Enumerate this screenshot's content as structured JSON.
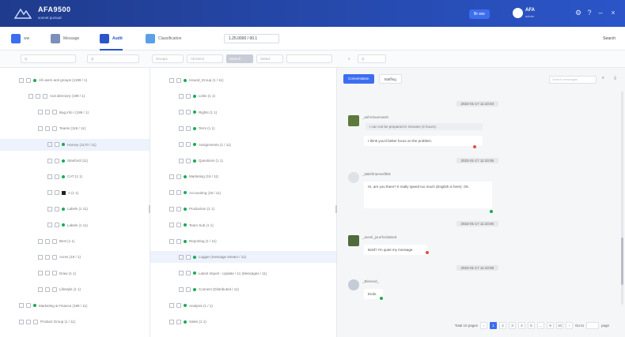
{
  "app": {
    "name": "AFA9500",
    "subtitle": "sonnet pursual"
  },
  "titlebar": {
    "button": "Br ww",
    "user_name": "AFA",
    "user_sub": "admin"
  },
  "colors": {
    "brand": "#2b55c8",
    "accent": "#3d6ef0",
    "online": "#1aaa55",
    "alert": "#e64b4b"
  },
  "nav": {
    "items": [
      {
        "label": "ww",
        "icon": "users-icon"
      },
      {
        "label": "Message",
        "icon": "chat-icon"
      },
      {
        "label": "Audit",
        "icon": "audit-icon"
      },
      {
        "label": "Classification",
        "icon": "cloud-icon"
      }
    ],
    "date": "1.25.0000 / 90.1",
    "search": "Search"
  },
  "filters": {
    "search1": "Q",
    "search2": "Q",
    "sel1": "Groups",
    "sel2": "All items",
    "pill": "Search",
    "sel3": "Select",
    "text": "Q"
  },
  "tree1": [
    {
      "label": "All users and groups (1199 / 1)",
      "indent": 0,
      "type": "dot"
    },
    {
      "label": "root directory (199 / 1)",
      "indent": 1,
      "type": "cb"
    },
    {
      "label": "Bug info / (199 / 1)",
      "indent": 2,
      "type": "cb"
    },
    {
      "label": "Teams (118 / 11)",
      "indent": 2,
      "type": "cb"
    },
    {
      "label": "Harvey (1170 / 11)",
      "indent": 3,
      "type": "dot",
      "selected": true
    },
    {
      "label": "Stanford (11)",
      "indent": 3,
      "type": "dot"
    },
    {
      "label": "CAT (1 1)",
      "indent": 3,
      "type": "dot"
    },
    {
      "label": "A (1 1)",
      "indent": 3,
      "type": "sq"
    },
    {
      "label": "Labels (1 11)",
      "indent": 3,
      "type": "dot"
    },
    {
      "label": "Labels (1 11)",
      "indent": 3,
      "type": "dot"
    },
    {
      "label": "Best (1 1)",
      "indent": 2,
      "type": "cb"
    },
    {
      "label": "Acres (19 / 1)",
      "indent": 2,
      "type": "cb"
    },
    {
      "label": "Draw (1 1)",
      "indent": 2,
      "type": "cb"
    },
    {
      "label": "Lifestyle (1 1)",
      "indent": 2,
      "type": "cb"
    },
    {
      "label": "Marketing & Finance (199 / 11)",
      "indent": 0,
      "type": "dot"
    },
    {
      "label": "Product Group (1 / 11)",
      "indent": 0,
      "type": "cb"
    }
  ],
  "tree2": [
    {
      "label": "Issued_Group (1 / 11)",
      "indent": 0,
      "type": "dot"
    },
    {
      "label": "Links (1 1)",
      "indent": 1,
      "type": "dot"
    },
    {
      "label": "Rights (1 1)",
      "indent": 1,
      "type": "dot"
    },
    {
      "label": "Term (1 1)",
      "indent": 1,
      "type": "dot"
    },
    {
      "label": "Assignments (1 / 11)",
      "indent": 1,
      "type": "dot"
    },
    {
      "label": "Questions (1 1)",
      "indent": 1,
      "type": "dot"
    },
    {
      "label": "Marketing (19 / 11)",
      "indent": 0,
      "type": "dot"
    },
    {
      "label": "Accounting (19 / 11)",
      "indent": 0,
      "type": "dot"
    },
    {
      "label": "Production (1 1)",
      "indent": 0,
      "type": "dot"
    },
    {
      "label": "Team Sub (1 1)",
      "indent": 0,
      "type": "dot"
    },
    {
      "label": "Reporting (1 / 11)",
      "indent": 0,
      "type": "dot"
    },
    {
      "label": "Logger (message stream / 11)",
      "indent": 1,
      "type": "dot",
      "selected": true
    },
    {
      "label": "Latest Import - Update / 11 (Messages / 11)",
      "indent": 1,
      "type": "dot"
    },
    {
      "label": "Connect (Distributed / 11)",
      "indent": 1,
      "type": "dot"
    },
    {
      "label": "Analysis (1 / 1)",
      "indent": 0,
      "type": "dot"
    },
    {
      "label": "Sales (1 1)",
      "indent": 0,
      "type": "dot"
    }
  ],
  "chat": {
    "tabs": [
      "Conversation",
      "Staffing"
    ],
    "search_placeholder": "Search messages",
    "messages": [
      {
        "time": "2022-01-17 11:10:03",
        "sender": "_ashrcbuerowsh",
        "quote": "I can not be prepared in minutes (4 hours).",
        "text": "I think you'd better focus on the problem.",
        "dot": "alert"
      },
      {
        "time": "2022-01-17 11:10:05",
        "sender": "_taBsfKiamxsftEE",
        "text": "Hi, are you there? It really speed too much (English is here). Ok.",
        "dot": "online"
      },
      {
        "time": "2022-01-17 11:10:06",
        "sender": "_aveel_jourrfordaDed",
        "text": "Bold? I'm quiet my message.",
        "dot": "alert"
      },
      {
        "time": "2022-01-17 11:10:09",
        "sender": "_Blessed_",
        "text": "Ends.",
        "dot": "online"
      }
    ]
  },
  "pager": {
    "total": "Total 10 pages",
    "pages": [
      "1",
      "2",
      "3",
      "4",
      "5",
      "...",
      "9",
      "10"
    ],
    "goto": "Go to",
    "page": "page"
  }
}
